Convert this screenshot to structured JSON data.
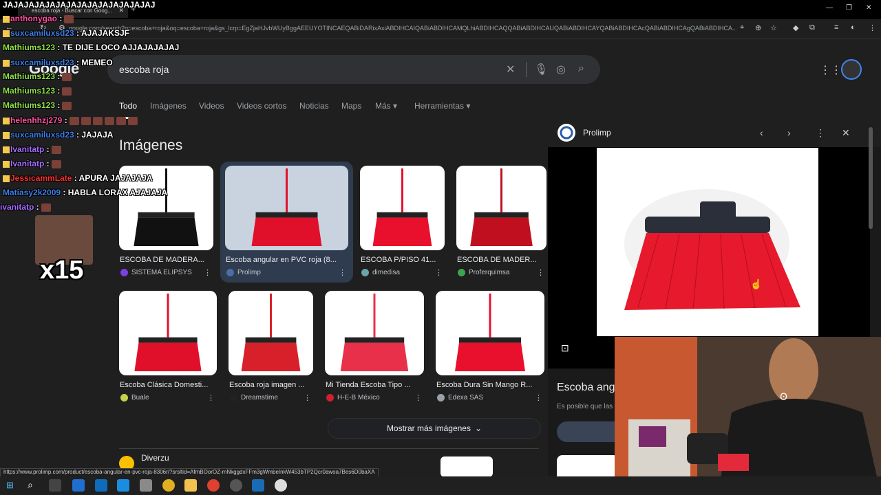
{
  "browser": {
    "tab_title": "escoba roja - Buscar con Goog...",
    "new_tab": "+",
    "url": "google.com/search?q=escoba+roja&oq=escoba+roja&gs_lcrp=EgZjaHJvbWUyBggAEEUYOTINCAEQABiDARixAxiABDIHCAIQABiABDIHCAMQLhiABDIHCAQQABiABDIHCAUQABiABDIHCAYQABiABDIHCAcQABiABDIHCAgQABiABDIHCA...",
    "status_url": "https://www.prolimp.com/product/escoba-angular-en-pvc-roja-8306r/?srsltid=AfmBOorOZ-mNkggdxFFm3gWmbeInkW453bTP2Qcr0awoa7Bes6D0baXA"
  },
  "google": {
    "logo": "Google",
    "query": "escoba roja",
    "nav": [
      "Todo",
      "Imágenes",
      "Videos",
      "Videos cortos",
      "Noticias",
      "Maps",
      "Más",
      "Herramientas"
    ],
    "images_heading": "Imágenes",
    "more_images": "Mostrar más imágenes",
    "next_result_source": "Diverzu"
  },
  "image_results": [
    {
      "caption": "ESCOBA DE MADERA...",
      "source": "SISTEMA ELIPSYS",
      "dot": "#7b3fe4",
      "broom": "#111111"
    },
    {
      "caption": "Escoba angular en PVC roja (8...",
      "source": "Prolimp",
      "dot": "#4a6fa5",
      "broom": "#e0102a"
    },
    {
      "caption": "ESCOBA P/PISO 41...",
      "source": "dimedisa",
      "dot": "#6aa3a8",
      "broom": "#e8102c"
    },
    {
      "caption": "ESCOBA DE MADER...",
      "source": "Proferquimsa",
      "dot": "#3fa34d",
      "broom": "#c01020"
    },
    {
      "caption": "Escoba Clásica Domesti...",
      "source": "Buale",
      "dot": "#c9d14a",
      "broom": "#e0102a"
    },
    {
      "caption": "Escoba roja imagen ...",
      "source": "Dreamstime",
      "dot": "#222222",
      "broom": "#d8202a"
    },
    {
      "caption": "Mi Tienda Escoba Tipo ...",
      "source": "H-E-B México",
      "dot": "#d02030",
      "broom": "#e8304a"
    },
    {
      "caption": "Escoba Dura Sin Mango R...",
      "source": "Edexa SAS",
      "dot": "#9aa0a6",
      "broom": "#e8102c"
    }
  ],
  "panel": {
    "site": "Prolimp",
    "title": "Escoba angu",
    "subtitle": "Es posible que las"
  },
  "chat": [
    {
      "user": "JAJAJAJAJAJAJAJAJAJAJAJAJAJAJ",
      "user_color": "#ffffff",
      "msg": ""
    },
    {
      "user": "anthonygao",
      "user_color": "#ff4fa0",
      "msg": ":"
    },
    {
      "user": "suxcamiluxsd23",
      "user_color": "#3d7fe6",
      "msg": ": AJAJAKSJF"
    },
    {
      "user": "Mathiums123",
      "user_color": "#8fe04a",
      "msg": ": TE DIJE LOCO AJJAJAJAJAJ"
    },
    {
      "user": "suxcamiluxsd23",
      "user_color": "#3d7fe6",
      "msg": ": MEMEO"
    },
    {
      "user": "Mathiums123",
      "user_color": "#8fe04a",
      "msg": ":"
    },
    {
      "user": "Mathiums123",
      "user_color": "#8fe04a",
      "msg": ":"
    },
    {
      "user": "Mathiums123",
      "user_color": "#8fe04a",
      "msg": ":"
    },
    {
      "user": "helenhhzj279",
      "user_color": "#ff4fa0",
      "msg": ":"
    },
    {
      "user": "suxcamiluxsd23",
      "user_color": "#3d7fe6",
      "msg": ": JAJAJA"
    },
    {
      "user": "Ivanitatp",
      "user_color": "#a56cff",
      "msg": ":"
    },
    {
      "user": "Ivanitatp",
      "user_color": "#a56cff",
      "msg": ":"
    },
    {
      "user": "JessicammLate",
      "user_color": "#ff3030",
      "msg": ": APURA JAJAJAJA"
    },
    {
      "user": "Matiasy2k2009",
      "user_color": "#3d7fe6",
      "msg": ": HABLA LORAX AJAJAJA"
    },
    {
      "user": "ivanitatp",
      "user_color": "#a56cff",
      "msg": ":"
    }
  ],
  "emote_multiplier": "x15"
}
